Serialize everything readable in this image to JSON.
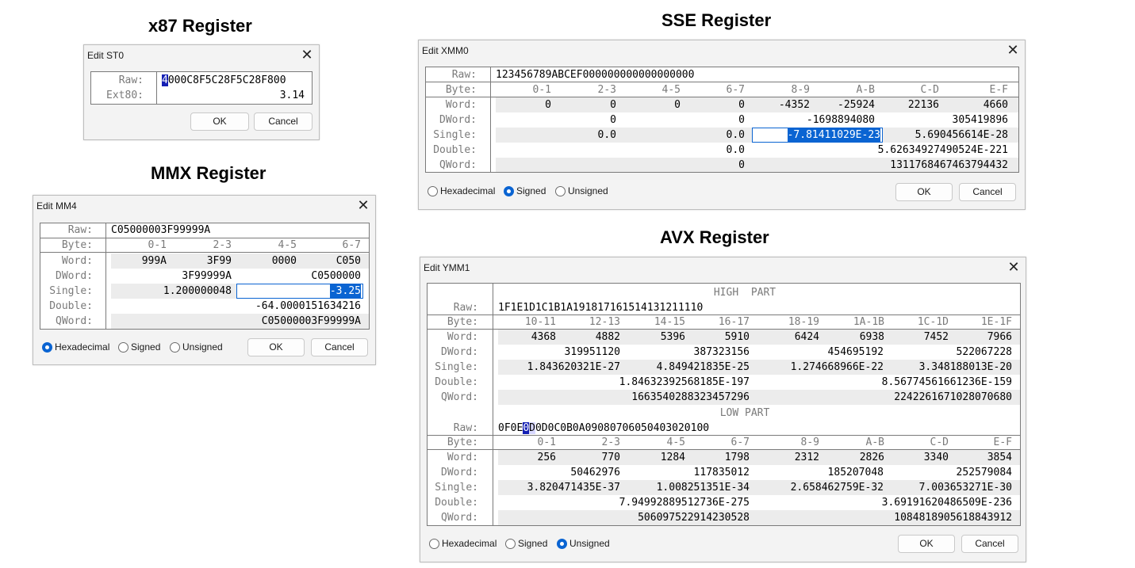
{
  "titles": {
    "x87": "x87 Register",
    "mmx": "MMX Register",
    "sse": "SSE Register",
    "avx": "AVX Register"
  },
  "buttons": {
    "ok": "OK",
    "cancel": "Cancel"
  },
  "radio_labels": {
    "hex": "Hexadecimal",
    "signed": "Signed",
    "unsigned": "Unsigned"
  },
  "row_labels": {
    "raw": "Raw:",
    "ext80": "Ext80:",
    "byte": "Byte:",
    "word": "Word:",
    "dword": "DWord:",
    "single": "Single:",
    "double": "Double:",
    "qword": "QWord:"
  },
  "x87": {
    "window_title": "Edit ST0",
    "raw_cursor": "4",
    "raw_rest": "000C8F5C28F5C28F800",
    "ext80": "3.14"
  },
  "mmx": {
    "window_title": "Edit MM4",
    "raw": "C05000003F99999A",
    "bytes": [
      "0-1",
      "2-3",
      "4-5",
      "6-7"
    ],
    "words": [
      "999A",
      "3F99",
      "0000",
      "C050"
    ],
    "dwords": [
      "3F99999A",
      "C0500000"
    ],
    "singles": [
      "1.200000048",
      "-3.25"
    ],
    "double": "-64.0000151634216",
    "qword": "C05000003F99999A",
    "selected_mode": "hex"
  },
  "sse": {
    "window_title": "Edit XMM0",
    "raw": "123456789ABCEF000000000000000000",
    "bytes": [
      "0-1",
      "2-3",
      "4-5",
      "6-7",
      "8-9",
      "A-B",
      "C-D",
      "E-F"
    ],
    "words": [
      "0",
      "0",
      "0",
      "0",
      "-4352",
      "-25924",
      "22136",
      "4660"
    ],
    "dwords": [
      "0",
      "0",
      "-1698894080",
      "305419896"
    ],
    "singles": [
      "0.0",
      "0.0",
      "-7.81411029E-23",
      "5.690456614E-28"
    ],
    "doubles": [
      "0.0",
      "5.62634927490524E-221"
    ],
    "qwords": [
      "0",
      "1311768467463794432"
    ],
    "selected_mode": "signed"
  },
  "avx": {
    "window_title": "Edit YMM1",
    "high_label": "HIGH  PART",
    "low_label": "LOW PART",
    "high": {
      "raw": "1F1E1D1C1B1A191817161514131211110",
      "bytes": [
        "10-11",
        "12-13",
        "14-15",
        "16-17",
        "18-19",
        "1A-1B",
        "1C-1D",
        "1E-1F"
      ],
      "words": [
        "4368",
        "4882",
        "5396",
        "5910",
        "6424",
        "6938",
        "7452",
        "7966"
      ],
      "dwords": [
        "319951120",
        "387323156",
        "454695192",
        "522067228"
      ],
      "singles": [
        "1.843620321E-27",
        "4.849421835E-25",
        "1.274668966E-22",
        "3.348188013E-20"
      ],
      "doubles": [
        "1.84632392568185E-197",
        "8.56774561661236E-159"
      ],
      "qwords": [
        "1663540288323457296",
        "2242261671028070680"
      ]
    },
    "low": {
      "raw_a": "0F0E",
      "raw_cursor": "0",
      "raw_b": "D",
      "raw_c": "0D0C0B0A09080706050403020100",
      "bytes": [
        "0-1",
        "2-3",
        "4-5",
        "6-7",
        "8-9",
        "A-B",
        "C-D",
        "E-F"
      ],
      "words": [
        "256",
        "770",
        "1284",
        "1798",
        "2312",
        "2826",
        "3340",
        "3854"
      ],
      "dwords": [
        "50462976",
        "117835012",
        "185207048",
        "252579084"
      ],
      "singles": [
        "3.820471435E-37",
        "1.008251351E-34",
        "2.658462759E-32",
        "7.003653271E-30"
      ],
      "doubles": [
        "7.94992889512736E-275",
        "3.69191620486509E-236"
      ],
      "qwords": [
        "506097522914230528",
        "1084818905618843912"
      ]
    },
    "selected_mode": "unsigned"
  },
  "colors": {
    "selection": "#0a64d2",
    "cursor": "#1520b4",
    "dialog_bg": "#f3f3f3",
    "label_gray": "#7a7a7a"
  }
}
